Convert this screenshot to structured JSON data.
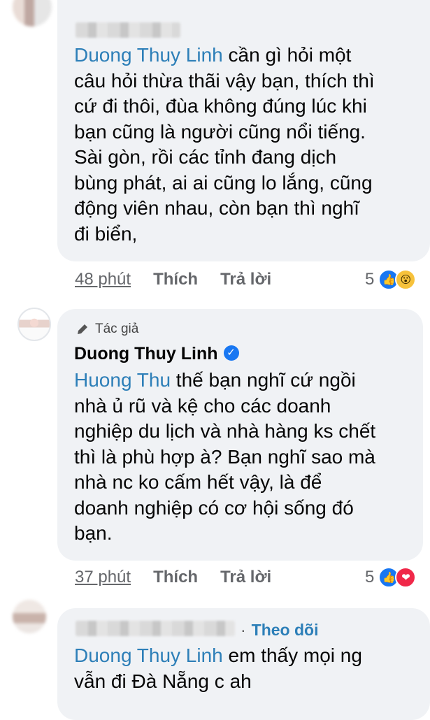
{
  "comment1": {
    "mention": "Duong Thuy Linh",
    "lines": [
      " cần gì hỏi một",
      "câu hỏi thừa thãi vậy bạn, thích thì",
      "cứ đi thôi, đùa không đúng lúc khi",
      "bạn cũng là người cũng nổi tiếng.",
      "Sài gòn, rồi các tỉnh đang dịch",
      "bùng phát, ai ai cũng lo lắng, cũng",
      "động viên nhau, còn bạn thì nghĩ",
      "đi biển,"
    ],
    "time": "48 phút",
    "like_label": "Thích",
    "reply_label": "Trả lời",
    "reaction_count": "5",
    "reaction_icons": [
      "like-icon",
      "wow-icon"
    ]
  },
  "comment2": {
    "author_badge": "Tác giả",
    "author_name": "Duong Thuy Linh",
    "mention": "Huong Thu",
    "lines": [
      " thế bạn nghĩ cứ ngồi",
      "nhà ủ rũ và kệ cho các doanh",
      "nghiệp du lịch và nhà hàng ks chết",
      "thì là phù hợp à? Bạn nghĩ sao mà",
      "nhà nc ko cấm hết vậy, là để",
      "doanh nghiệp có cơ hội sống đó",
      "bạn."
    ],
    "time": "37 phút",
    "like_label": "Thích",
    "reply_label": "Trả lời",
    "reaction_count": "5",
    "reaction_icons": [
      "like-icon",
      "love-icon"
    ]
  },
  "comment3": {
    "follow_label": "Theo dõi",
    "separator": "·",
    "mention": "Duong Thuy Linh",
    "lines": [
      " em thấy mọi ng",
      "vẫn đi Đà Nẵng c ah"
    ]
  },
  "colors": {
    "bubble": "#f0f2f5",
    "mention": "#2d7fb8",
    "meta": "#65676b",
    "like": "#1877f2",
    "love": "#f02849",
    "wow": "#f7c23b"
  }
}
